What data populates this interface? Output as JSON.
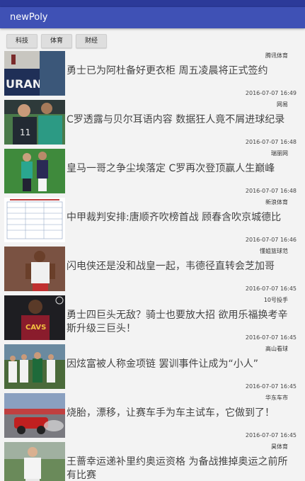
{
  "app": {
    "title": "newPoly"
  },
  "tabs": [
    {
      "label": "科技"
    },
    {
      "label": "体育"
    },
    {
      "label": "财经"
    }
  ],
  "news": [
    {
      "source": "腾讯体育",
      "title": "勇士已为阿杜备好更衣柜 周五凌晨将正式签约",
      "time": "2016-07-07 16:49",
      "image": "basketball-jersey-photo"
    },
    {
      "source": "网易",
      "title": "C罗透露与贝尔耳语内容 数据狂人竟不屑进球纪录",
      "time": "2016-07-07 16:48",
      "image": "soccer-players-photo"
    },
    {
      "source": "瑞丽网",
      "title": "皇马一哥之争尘埃落定 C罗再次登顶赢人生巅峰",
      "time": "2016-07-07 16:48",
      "image": "soccer-match-photo"
    },
    {
      "source": "新浪体育",
      "title": "中甲裁判安排:唐顺齐吹榜首战 顾春含吹京城德比",
      "time": "2016-07-07 16:46",
      "image": "referee-schedule-table"
    },
    {
      "source": "懂姐篮球范",
      "title": "闪电侠还是没和战皇一起，韦德径直转会芝加哥",
      "time": "2016-07-07 16:45",
      "image": "basketball-player-photo"
    },
    {
      "source": "10号投手",
      "title": "勇士四巨头无敌？骑士也要放大招 欲用乐福换考辛斯升级三巨头！",
      "time": "2016-07-07 16:45",
      "image": "cavaliers-player-photo"
    },
    {
      "source": "高山看球",
      "title": "因炫富被人称金项链 罢训事件让成为“小人”",
      "time": "2016-07-07 16:45",
      "image": "soccer-team-photo"
    },
    {
      "source": "华东车市",
      "title": "烧胎，漂移，让赛车手为车主试车，它做到了！",
      "time": "2016-07-07 16:45",
      "image": "racing-car-photo"
    },
    {
      "source": "昊体育",
      "title": "王蔷幸运递补里约奥运资格 为备战推掉奥运之前所有比赛",
      "time": "",
      "image": "tennis-player-photo"
    }
  ]
}
